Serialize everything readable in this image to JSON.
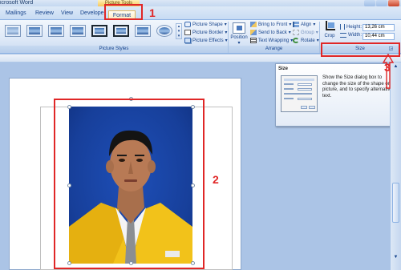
{
  "window": {
    "app_title": "icrosoft Word",
    "context_tab_group": "Picture Tools"
  },
  "tabs": {
    "mailings": "Mailings",
    "review": "Review",
    "view": "View",
    "developer": "Developer",
    "format": "Format"
  },
  "ribbon": {
    "picture_styles": {
      "label": "Picture Styles",
      "picture_shape": "Picture Shape",
      "picture_border": "Picture Border",
      "picture_effects": "Picture Effects"
    },
    "arrange": {
      "label": "Arrange",
      "position": "Position",
      "bring_to_front": "Bring to Front",
      "send_to_back": "Send to Back",
      "text_wrapping": "Text Wrapping",
      "align": "Align",
      "group": "Group",
      "rotate": "Rotate"
    },
    "size": {
      "label": "Size",
      "crop": "Crop",
      "height_label": "Height:",
      "height_value": "13,26 cm",
      "width_label": "Width:",
      "width_value": "10,44 cm"
    }
  },
  "tooltip": {
    "title": "Size",
    "text": "Show the Size dialog box to change the size of the shape or picture, and to specify alternative text."
  },
  "annotations": {
    "one": "1",
    "two": "2",
    "three": "3"
  },
  "colors": {
    "annotation_red": "#e02727",
    "ribbon_blue": "#dde8f7",
    "context_tab": "#f7c75a",
    "photo_background": "#1e4fb8",
    "jacket_yellow": "#f2c21a"
  }
}
